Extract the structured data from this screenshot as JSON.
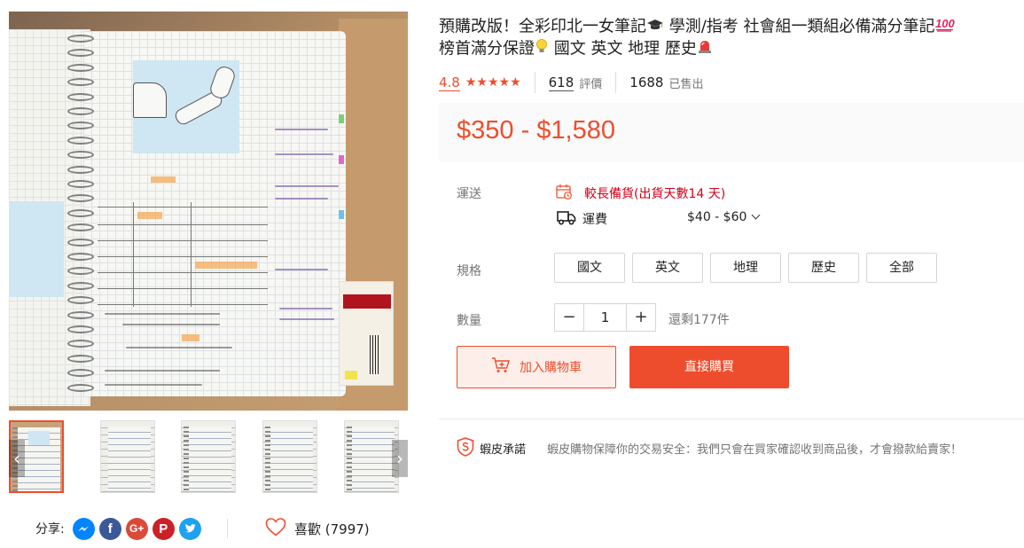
{
  "product": {
    "title_part1": "預購改版！全彩印北一女筆記",
    "title_part2": " 學測/指考 社會組一類組必備滿分筆記",
    "title_part3": "榜首滿分保證",
    "title_part4": " 國文 英文 地理 歷史",
    "title_icons": [
      "graduation-cap-icon",
      "hundred-points-icon",
      "light-bulb-icon",
      "siren-icon"
    ]
  },
  "rating": {
    "score": "4.8",
    "stars": "★★★★★",
    "review_count": "618",
    "review_label": "評價",
    "sold_count": "1688",
    "sold_label": "已售出"
  },
  "price": {
    "range": "$350 - $1,580"
  },
  "shipping": {
    "label": "運送",
    "backorder_text": "較長備貨(出貨天數14 天)",
    "fee_label": "運費",
    "fee_value": "$40 - $60"
  },
  "variants": {
    "label": "規格",
    "options": [
      "國文",
      "英文",
      "地理",
      "歷史",
      "全部"
    ]
  },
  "quantity": {
    "label": "數量",
    "minus": "−",
    "value": "1",
    "plus": "+",
    "stock_text": "還剩177件"
  },
  "actions": {
    "add_to_cart": "加入購物車",
    "buy_now": "直接購買"
  },
  "guarantee": {
    "title": "蝦皮承諾",
    "text": "蝦皮購物保障你的交易安全：我們只會在買家確認收到商品後，才會撥款給賣家！"
  },
  "share": {
    "label": "分享:",
    "networks": [
      "Messenger",
      "Facebook",
      "Google+",
      "Pinterest",
      "Twitter"
    ]
  },
  "like": {
    "label": "喜歡 (7997)"
  },
  "gallery": {
    "prev": "‹",
    "next": "›",
    "thumbnail_count": 5
  },
  "colors": {
    "accent": "#ee4d2d",
    "backorder": "#d0011b",
    "price_bg": "#fafafa"
  }
}
